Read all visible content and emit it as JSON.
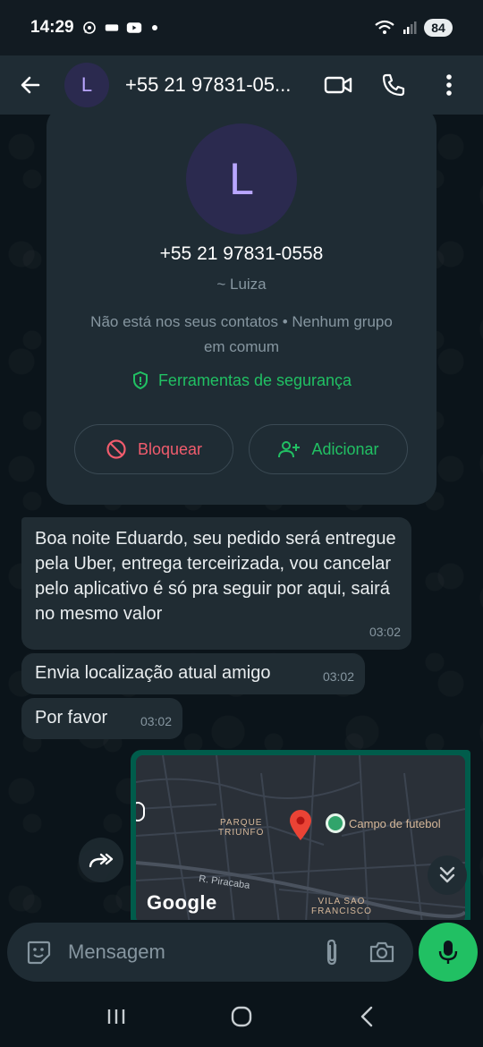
{
  "status_bar": {
    "time": "14:29",
    "battery": "84"
  },
  "header": {
    "avatar_letter": "L",
    "title": "+55 21 97831-05..."
  },
  "contact_card": {
    "avatar_letter": "L",
    "phone": "+55 21 97831-0558",
    "name": "~ Luiza",
    "info": "Não está nos seus contatos • Nenhum grupo em comum",
    "safety_tools": "Ferramentas de segurança",
    "block_label": "Bloquear",
    "add_label": "Adicionar"
  },
  "messages": [
    {
      "text": "Boa noite Eduardo, seu pedido será entregue pela Uber, entrega terceirizada, vou cancelar pelo aplicativo é só pra seguir por aqui, sairá no mesmo valor",
      "time": "03:02"
    },
    {
      "text": "Envia localização atual amigo",
      "time": "03:02"
    },
    {
      "text": "Por favor",
      "time": "03:02"
    }
  ],
  "map": {
    "area1": "PARQUE\nTRIUNFO",
    "area2": "VILA SAO\nFRANCISCO",
    "poi": "Campo de futebol",
    "road": "R. Piracaba",
    "logo": "Google"
  },
  "compose": {
    "placeholder": "Mensagem"
  },
  "colors": {
    "accent_green": "#21c063",
    "danger_red": "#f15c6d",
    "bubble_incoming": "#202c33",
    "bubble_outgoing": "#005c4b"
  }
}
